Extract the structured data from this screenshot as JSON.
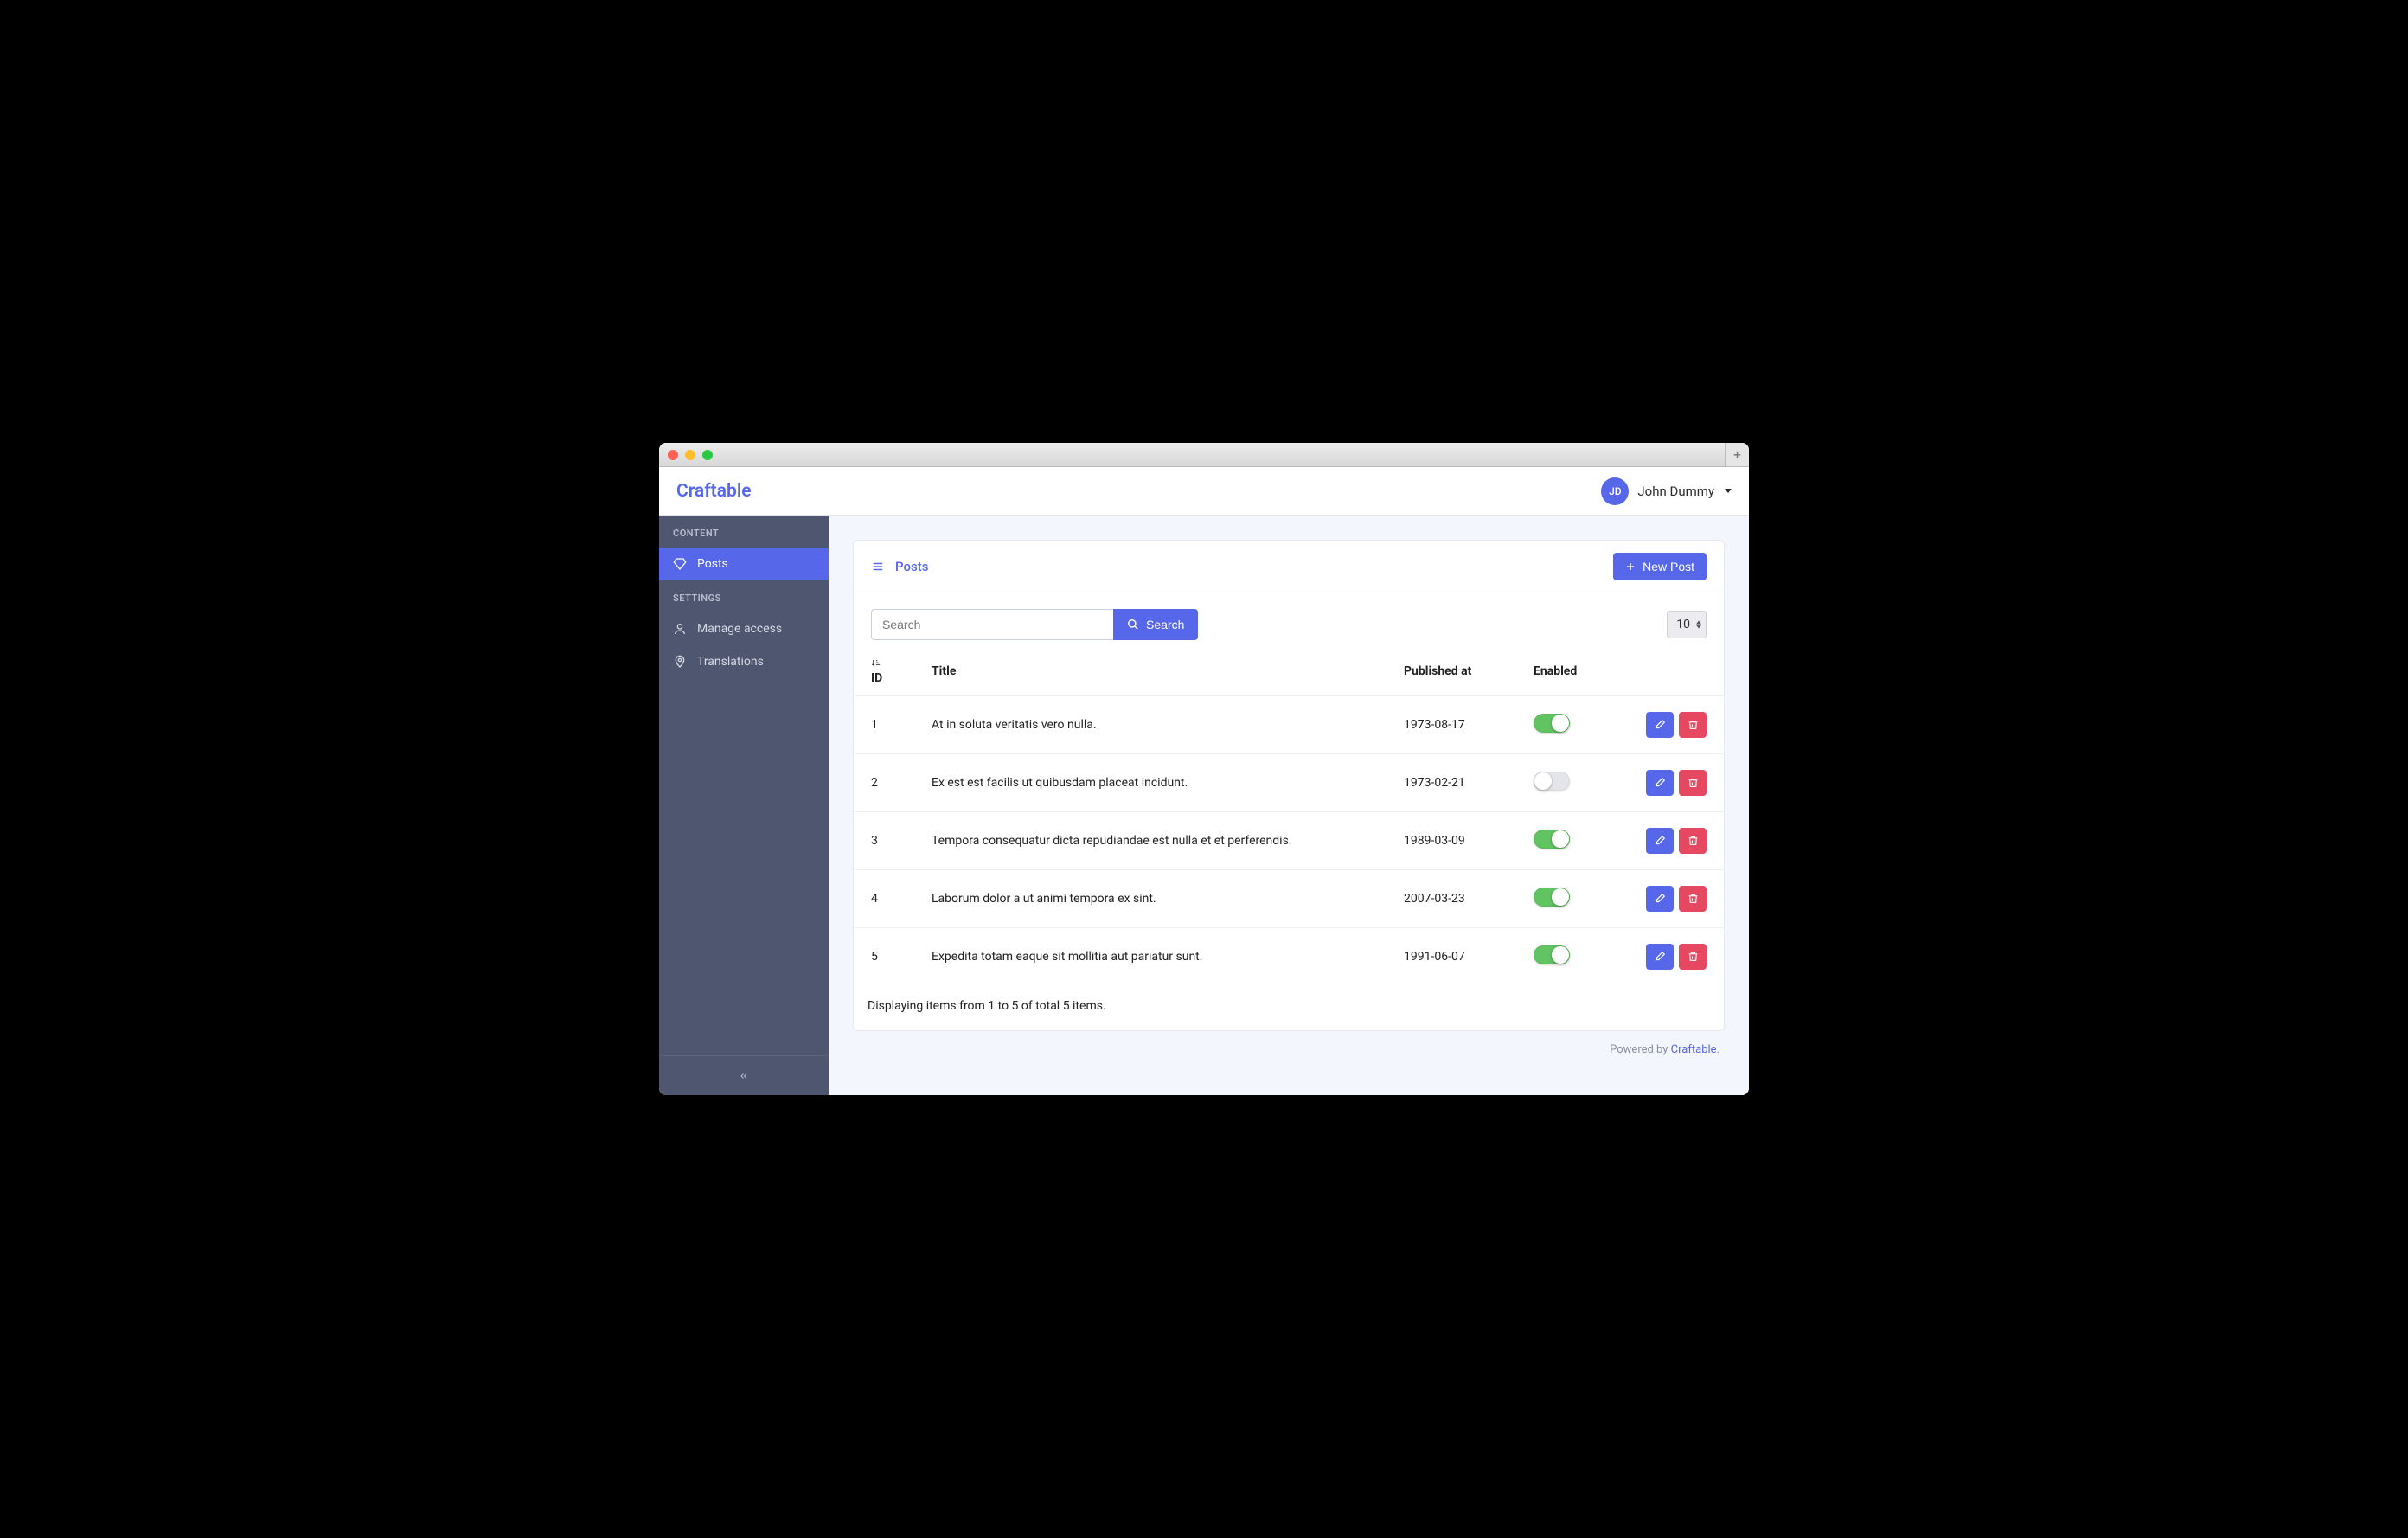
{
  "brand": "Craftable",
  "user": {
    "initials": "JD",
    "name": "John Dummy"
  },
  "sidebar": {
    "sections": [
      {
        "label": "CONTENT",
        "items": [
          {
            "label": "Posts",
            "active": true,
            "icon": "diamond-icon"
          }
        ]
      },
      {
        "label": "SETTINGS",
        "items": [
          {
            "label": "Manage access",
            "active": false,
            "icon": "user-icon"
          },
          {
            "label": "Translations",
            "active": false,
            "icon": "pin-icon"
          }
        ]
      }
    ]
  },
  "page": {
    "title": "Posts",
    "new_button_label": "New Post",
    "search_placeholder": "Search",
    "search_button_label": "Search",
    "per_page_value": "10",
    "columns": {
      "id": "ID",
      "title": "Title",
      "published_at": "Published at",
      "enabled": "Enabled"
    },
    "rows": [
      {
        "id": "1",
        "title": "At in soluta veritatis vero nulla.",
        "published_at": "1973-08-17",
        "enabled": true
      },
      {
        "id": "2",
        "title": "Ex est est facilis ut quibusdam placeat incidunt.",
        "published_at": "1973-02-21",
        "enabled": false
      },
      {
        "id": "3",
        "title": "Tempora consequatur dicta repudiandae est nulla et et perferendis.",
        "published_at": "1989-03-09",
        "enabled": true
      },
      {
        "id": "4",
        "title": "Laborum dolor a ut animi tempora ex sint.",
        "published_at": "2007-03-23",
        "enabled": true
      },
      {
        "id": "5",
        "title": "Expedita totam eaque sit mollitia aut pariatur sunt.",
        "published_at": "1991-06-07",
        "enabled": true
      }
    ],
    "pagination_summary": "Displaying items from 1 to 5 of total 5 items."
  },
  "footer": {
    "prefix": "Powered by ",
    "link_text": "Craftable",
    "suffix": "."
  },
  "colors": {
    "primary": "#5667e9",
    "danger": "#e54860",
    "sidebar_bg": "#4f566f",
    "toggle_on": "#62c362"
  }
}
